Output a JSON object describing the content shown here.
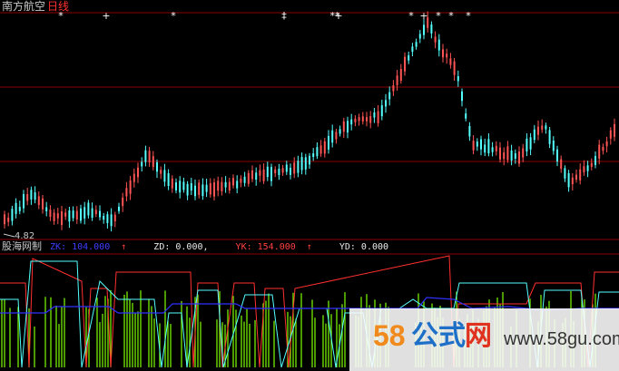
{
  "header": {
    "stock_name": "南方航空",
    "period": "日线"
  },
  "main_panel": {
    "low_price_label": "4.82",
    "marker_glyphs": [
      "*",
      "+",
      "*",
      "‡",
      "**",
      "+",
      "*",
      "+",
      "*",
      "*",
      "*"
    ]
  },
  "indicator": {
    "name": "股海网制",
    "values": [
      {
        "label": "ZK: 104.000",
        "arrow": "↑",
        "color": "#3c3cff"
      },
      {
        "label": "ZD: 0.000,",
        "arrow": "",
        "color": "#e8e8e8"
      },
      {
        "label": "YK: 154.000",
        "arrow": "↑",
        "color": "#ff4040"
      },
      {
        "label": "YD: 0.000",
        "arrow": "",
        "color": "#e8e8e8"
      }
    ]
  },
  "watermark": {
    "digits": "58",
    "gongshi": "公式",
    "wang": "网",
    "url": "www.58gu.com"
  },
  "colors": {
    "up": "#ff5454",
    "down": "#54ffff",
    "grid": "#8b0000",
    "blue": "#3030ff",
    "green": "#7fff00"
  }
}
